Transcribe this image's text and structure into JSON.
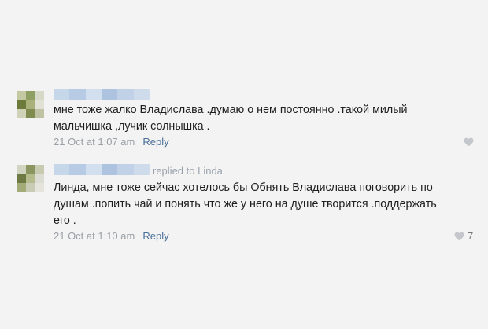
{
  "comments": [
    {
      "text": "мне тоже жалко Владислава .думаю о нем постоянно .такой милый мальчишка ,лучик солнышка .",
      "timestamp": "21 Oct at 1:07 am",
      "reply_label": "Reply",
      "like_icon": "heart-icon",
      "avatar_colors": [
        "#c4c9a2",
        "#8f9e63",
        "#d6d8c8",
        "#6c7a3c",
        "#a9b07a",
        "#e1e1d6",
        "#cfd2b7",
        "#7f8b4f",
        "#bfc3a3"
      ]
    },
    {
      "replied_to": "replied to Linda",
      "text": "Линда, мне тоже сейчас хотелось бы Обнять Владислава поговорить по душам .попить чай и понять что же у него на душе творится .поддержать его .",
      "timestamp": "21 Oct at 1:10 am",
      "reply_label": "Reply",
      "like_icon": "heart-icon",
      "like_count": "7",
      "avatar_colors": [
        "#d2d4c2",
        "#8a9560",
        "#c8cbb0",
        "#6e7a43",
        "#b6bb8e",
        "#dcddd2",
        "#a3ab78",
        "#c9ccb4",
        "#e4e4dc"
      ]
    }
  ],
  "colors": {
    "background": "#f3f3f3",
    "link": "#4a6f99",
    "meta": "#9aa0a6",
    "name_blur": [
      "#c7d7ea",
      "#b8cbe4",
      "#d2dfee",
      "#aec3df",
      "#c0d1e8",
      "#cddbeb"
    ]
  }
}
